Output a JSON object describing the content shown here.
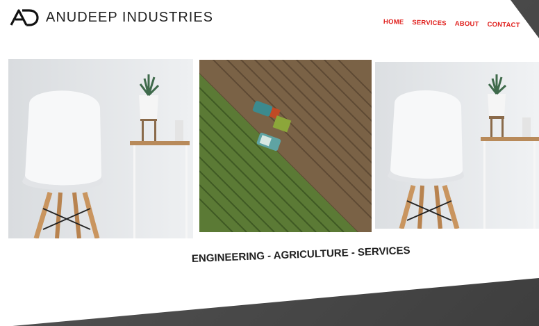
{
  "header": {
    "brand_name": "ANUDEEP INDUSTRIES",
    "logo_icon": "ad-monogram-icon"
  },
  "nav": {
    "items": [
      {
        "label": "HOME"
      },
      {
        "label": "SERVICES"
      },
      {
        "label": "ABOUT"
      },
      {
        "label": "CONTACT"
      }
    ]
  },
  "gallery": {
    "images": [
      {
        "subject": "white chair beside side table with potted plant"
      },
      {
        "subject": "aerial view of tractors harvesting a field"
      },
      {
        "subject": "white chair beside side table with potted plant"
      }
    ]
  },
  "tagline": "ENGINEERING - AGRICULTURE - SERVICES",
  "colors": {
    "accent": "#e0201d",
    "text": "#1f1f1f",
    "background": "#ffffff"
  }
}
